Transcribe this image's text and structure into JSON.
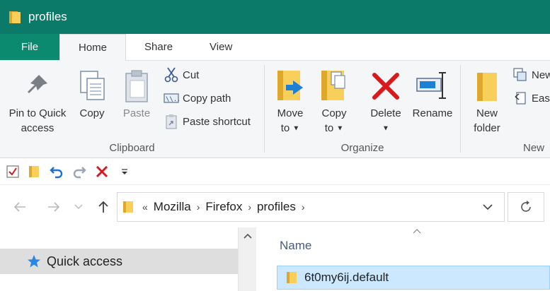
{
  "window": {
    "title": "profiles"
  },
  "ribbon_tabs": [
    "File",
    "Home",
    "Share",
    "View"
  ],
  "clipboard": {
    "pin_label_1": "Pin to Quick",
    "pin_label_2": "access",
    "copy_label": "Copy",
    "paste_label": "Paste",
    "cut_label": "Cut",
    "copy_path_label": "Copy path",
    "paste_shortcut_label": "Paste shortcut",
    "group_label": "Clipboard"
  },
  "organize": {
    "move_to_1": "Move",
    "move_to_2": "to",
    "copy_to_1": "Copy",
    "copy_to_2": "to",
    "delete_label": "Delete",
    "rename_label": "Rename",
    "group_label": "Organize"
  },
  "new_group": {
    "new_folder_1": "New",
    "new_folder_2": "folder",
    "new_item_label": "New",
    "easy_access_label": "Eas",
    "group_label": "New"
  },
  "address_bar": {
    "overflow": "«",
    "crumbs": [
      "Mozilla",
      "Firefox",
      "profiles"
    ]
  },
  "nav_pane": {
    "quick_access_label": "Quick access"
  },
  "file_list": {
    "column_name": "Name",
    "items": [
      {
        "name": "6t0my6ij.default",
        "selected": true
      }
    ]
  },
  "colors": {
    "titlebar": "#0b7a68",
    "file_tab": "#0b8a6f",
    "selection": "#cce8ff",
    "delete_red": "#d9191b"
  },
  "icons": [
    "folder-icon",
    "pin-icon",
    "copy-icon",
    "paste-icon",
    "scissors-icon",
    "copy-path-icon",
    "paste-shortcut-icon",
    "move-to-icon",
    "copy-to-icon",
    "delete-x-icon",
    "rename-icon",
    "new-folder-icon",
    "new-item-icon",
    "easy-access-icon",
    "properties-check-icon",
    "undo-icon",
    "redo-icon",
    "back-arrow-icon",
    "forward-arrow-icon",
    "recent-chevron-icon",
    "up-arrow-icon",
    "refresh-icon",
    "star-icon"
  ]
}
